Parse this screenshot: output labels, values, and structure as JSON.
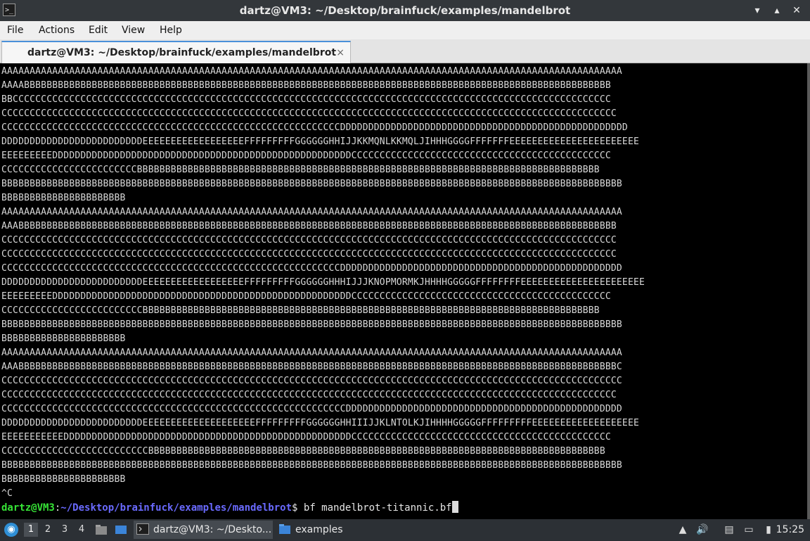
{
  "window": {
    "title": "dartz@VM3: ~/Desktop/brainfuck/examples/mandelbrot",
    "icon": "terminal-icon",
    "minimize": "minimize-icon",
    "maximize": "maximize-icon",
    "close": "close-icon"
  },
  "menu": {
    "items": [
      "File",
      "Actions",
      "Edit",
      "View",
      "Help"
    ]
  },
  "tab": {
    "label": "dartz@VM3: ~/Desktop/brainfuck/examples/mandelbrot",
    "close": "×"
  },
  "terminal": {
    "lines": [
      "AAAAAAAAAAAAAAAAAAAAAAAAAAAAAAAAAAAAAAAAAAAAAAAAAAAAAAAAAAAAAAAAAAAAAAAAAAAAAAAAAAAAAAAAAAAAAAAAAAAAAAAAAAAAAA",
      "AAAABBBBBBBBBBBBBBBBBBBBBBBBBBBBBBBBBBBBBBBBBBBBBBBBBBBBBBBBBBBBBBBBBBBBBBBBBBBBBBBBBBBBBBBBBBBBBBBBBBBBBBBB",
      "BBCCCCCCCCCCCCCCCCCCCCCCCCCCCCCCCCCCCCCCCCCCCCCCCCCCCCCCCCCCCCCCCCCCCCCCCCCCCCCCCCCCCCCCCCCCCCCCCCCCCCCCCCCC",
      "CCCCCCCCCCCCCCCCCCCCCCCCCCCCCCCCCCCCCCCCCCCCCCCCCCCCCCCCCCCCCCCCCCCCCCCCCCCCCCCCCCCCCCCCCCCCCCCCCCCCCCCCCCCCC",
      "CCCCCCCCCCCCCCCCCCCCCCCCCCCCCCCCCCCCCCCCCCCCCCCCCCCCCCCCCCCCDDDDDDDDDDDDDDDDDDDDDDDDDDDDDDDDDDDDDDDDDDDDDDDDDDD",
      "DDDDDDDDDDDDDDDDDDDDDDDDDEEEEEEEEEEEEEEEEEEFFFFFFFFFGGGGGGHHIJJKKMQNLKKMQLJIHHHGGGGFFFFFFFEEEEEEEEEEEEEEEEEEEEEEE",
      "EEEEEEEEEDDDDDDDDDDDDDDDDDDDDDDDDDDDDDDDDDDDDDDDDDDDDDDDDDDDDDCCCCCCCCCCCCCCCCCCCCCCCCCCCCCCCCCCCCCCCCCCCCCC",
      "CCCCCCCCCCCCCCCCCCCCCCCCBBBBBBBBBBBBBBBBBBBBBBBBBBBBBBBBBBBBBBBBBBBBBBBBBBBBBBBBBBBBBBBBBBBBBBBBBBBBBBBBBB",
      "BBBBBBBBBBBBBBBBBBBBBBBBBBBBBBBBBBBBBBBBBBBBBBBBBBBBBBBBBBBBBBBBBBBBBBBBBBBBBBBBBBBBBBBBBBBBBBBBBBBBBBBBBBBBBB",
      "BBBBBBBBBBBBBBBBBBBBBB",
      "AAAAAAAAAAAAAAAAAAAAAAAAAAAAAAAAAAAAAAAAAAAAAAAAAAAAAAAAAAAAAAAAAAAAAAAAAAAAAAAAAAAAAAAAAAAAAAAAAAAAAAAAAAAAAA",
      "AAABBBBBBBBBBBBBBBBBBBBBBBBBBBBBBBBBBBBBBBBBBBBBBBBBBBBBBBBBBBBBBBBBBBBBBBBBBBBBBBBBBBBBBBBBBBBBBBBBBBBBBBBBB",
      "CCCCCCCCCCCCCCCCCCCCCCCCCCCCCCCCCCCCCCCCCCCCCCCCCCCCCCCCCCCCCCCCCCCCCCCCCCCCCCCCCCCCCCCCCCCCCCCCCCCCCCCCCCCCC",
      "CCCCCCCCCCCCCCCCCCCCCCCCCCCCCCCCCCCCCCCCCCCCCCCCCCCCCCCCCCCCCCCCCCCCCCCCCCCCCCCCCCCCCCCCCCCCCCCCCCCCCCCCCCCCC",
      "CCCCCCCCCCCCCCCCCCCCCCCCCCCCCCCCCCCCCCCCCCCCCCCCCCCCCCCCCCCCDDDDDDDDDDDDDDDDDDDDDDDDDDDDDDDDDDDDDDDDDDDDDDDDDD",
      "DDDDDDDDDDDDDDDDDDDDDDDDDEEEEEEEEEEEEEEEEEEFFFFFFFFFGGGGGGHHHIJJJKNOPMORMKJHHHHGGGGGFFFFFFFFEEEEEEEEEEEEEEEEEEEEEE",
      "EEEEEEEEEDDDDDDDDDDDDDDDDDDDDDDDDDDDDDDDDDDDDDDDDDDDDDDDDDDDDDCCCCCCCCCCCCCCCCCCCCCCCCCCCCCCCCCCCCCCCCCCCCCC",
      "CCCCCCCCCCCCCCCCCCCCCCCCCBBBBBBBBBBBBBBBBBBBBBBBBBBBBBBBBBBBBBBBBBBBBBBBBBBBBBBBBBBBBBBBBBBBBBBBBBBBBBBBBB",
      "BBBBBBBBBBBBBBBBBBBBBBBBBBBBBBBBBBBBBBBBBBBBBBBBBBBBBBBBBBBBBBBBBBBBBBBBBBBBBBBBBBBBBBBBBBBBBBBBBBBBBBBBBBBBBB",
      "BBBBBBBBBBBBBBBBBBBBBB",
      "AAAAAAAAAAAAAAAAAAAAAAAAAAAAAAAAAAAAAAAAAAAAAAAAAAAAAAAAAAAAAAAAAAAAAAAAAAAAAAAAAAAAAAAAAAAAAAAAAAAAAAAAAAAAAA",
      "AAABBBBBBBBBBBBBBBBBBBBBBBBBBBBBBBBBBBBBBBBBBBBBBBBBBBBBBBBBBBBBBBBBBBBBBBBBBBBBBBBBBBBBBBBBBBBBBBBBBBBBBBBBBC",
      "CCCCCCCCCCCCCCCCCCCCCCCCCCCCCCCCCCCCCCCCCCCCCCCCCCCCCCCCCCCCCCCCCCCCCCCCCCCCCCCCCCCCCCCCCCCCCCCCCCCCCCCCCCCCCC",
      "CCCCCCCCCCCCCCCCCCCCCCCCCCCCCCCCCCCCCCCCCCCCCCCCCCCCCCCCCCCCCCCCCCCCCCCCCCCCCCCCCCCCCCCCCCCCCCCCCCCCCCCCCCCCC",
      "CCCCCCCCCCCCCCCCCCCCCCCCCCCCCCCCCCCCCCCCCCCCCCCCCCCCCCCCCCCCCDDDDDDDDDDDDDDDDDDDDDDDDDDDDDDDDDDDDDDDDDDDDDDDDD",
      "DDDDDDDDDDDDDDDDDDDDDDDDDEEEEEEEEEEEEEEEEEEEEFFFFFFFFFGGGGGGHHIIIJJKLNTOLKJIHHHHGGGGGFFFFFFFFFEEEEEEEEEEEEEEEEEEE",
      "EEEEEEEEEEEDDDDDDDDDDDDDDDDDDDDDDDDDDDDDDDDDDDDDDDDDDDDDDDDDDDCCCCCCCCCCCCCCCCCCCCCCCCCCCCCCCCCCCCCCCCCCCCCC",
      "CCCCCCCCCCCCCCCCCCCCCCCCCCBBBBBBBBBBBBBBBBBBBBBBBBBBBBBBBBBBBBBBBBBBBBBBBBBBBBBBBBBBBBBBBBBBBBBBBBBBBBBBBBB",
      "BBBBBBBBBBBBBBBBBBBBBBBBBBBBBBBBBBBBBBBBBBBBBBBBBBBBBBBBBBBBBBBBBBBBBBBBBBBBBBBBBBBBBBBBBBBBBBBBBBBBBBBBBBBBBB",
      "BBBBBBBBBBBBBBBBBBBBBB",
      "^C"
    ],
    "prompt_user": "dartz@VM3",
    "prompt_sep": ":",
    "prompt_path": "~/Desktop/brainfuck/examples/mandelbrot",
    "prompt_dollar": "$ ",
    "command": "bf mandelbrot-titannic.bf"
  },
  "taskbar": {
    "start_icon": "distro-logo-icon",
    "workspaces": [
      "1",
      "2",
      "3",
      "4"
    ],
    "tasks": [
      {
        "label": "dartz@VM3: ~/Deskto...",
        "icon": "terminal-icon"
      },
      {
        "label": "examples",
        "icon": "folder-icon"
      }
    ],
    "clock": "15:25"
  }
}
